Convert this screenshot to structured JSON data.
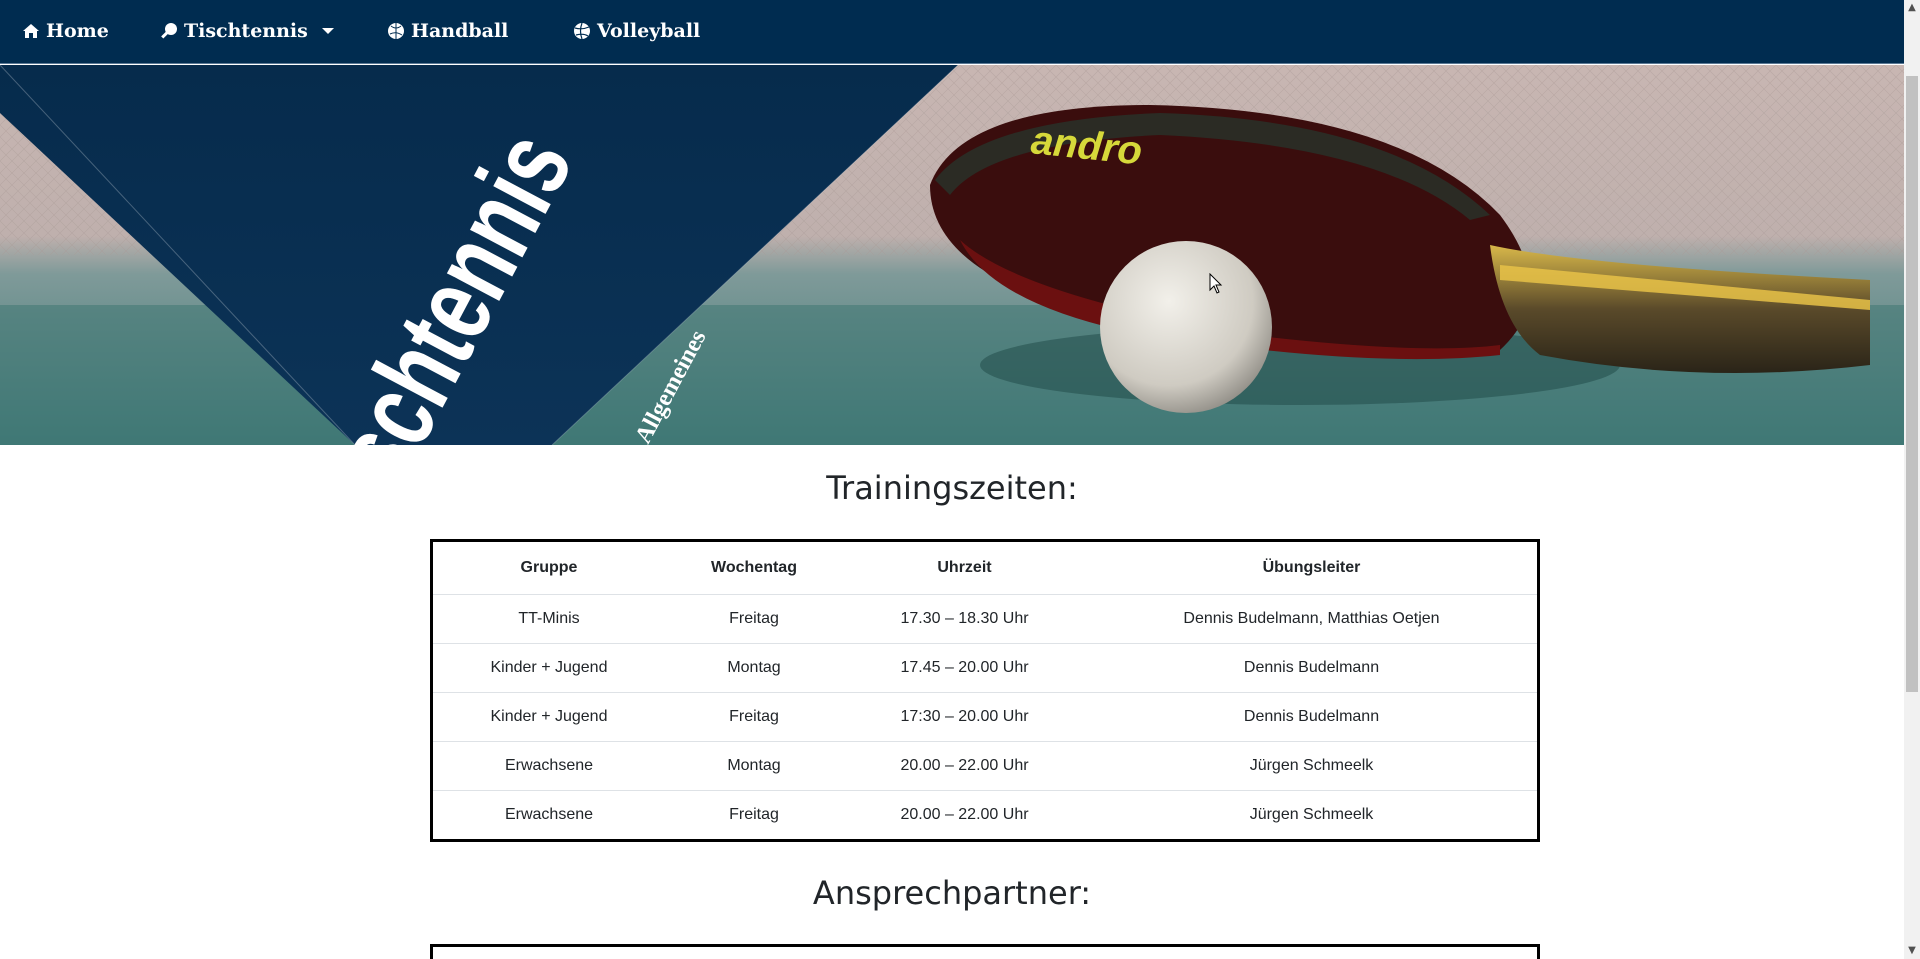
{
  "nav": {
    "home": "Home",
    "tischtennis": "Tischtennis",
    "handball": "Handball",
    "volleyball": "Volleyball"
  },
  "hero": {
    "title": "Tischtennis",
    "subtitle": "Allgemeines",
    "brand_text": "andro"
  },
  "training": {
    "heading": "Trainingszeiten:",
    "columns": [
      "Gruppe",
      "Wochentag",
      "Uhrzeit",
      "Übungsleiter"
    ],
    "rows": [
      [
        "TT-Minis",
        "Freitag",
        "17.30 – 18.30 Uhr",
        "Dennis Budelmann, Matthias Oetjen"
      ],
      [
        "Kinder + Jugend",
        "Montag",
        "17.45 – 20.00 Uhr",
        "Dennis Budelmann"
      ],
      [
        "Kinder + Jugend",
        "Freitag",
        "17:30 – 20.00 Uhr",
        "Dennis Budelmann"
      ],
      [
        "Erwachsene",
        "Montag",
        "20.00 – 22.00 Uhr",
        "Jürgen Schmeelk"
      ],
      [
        "Erwachsene",
        "Freitag",
        "20.00 – 22.00 Uhr",
        "Jürgen Schmeelk"
      ]
    ]
  },
  "contact": {
    "heading": "Ansprechpartner:"
  },
  "colors": {
    "navbar": "#002c50",
    "hero_panel": "#0a2a4a"
  }
}
